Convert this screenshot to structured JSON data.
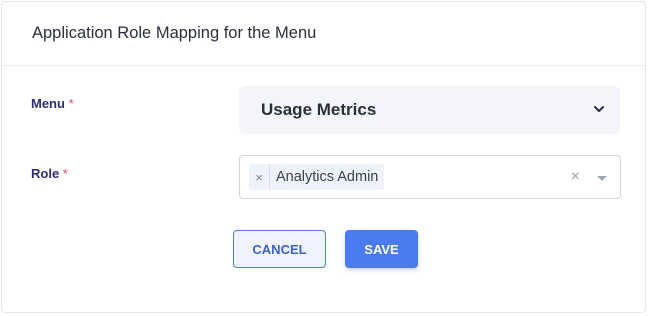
{
  "dialog": {
    "title": "Application Role Mapping for the Menu"
  },
  "menu_field": {
    "label": "Menu",
    "required_mark": "*",
    "selected_value": "Usage Metrics",
    "chevron_icon": "chevron-down-icon"
  },
  "role_field": {
    "label": "Role",
    "required_mark": "*",
    "selected_tags": [
      {
        "label": "Analytics Admin",
        "remove_symbol": "×"
      }
    ],
    "clear_symbol": "×",
    "dropdown_icon": "caret-down-icon"
  },
  "actions": {
    "cancel_label": "CANCEL",
    "save_label": "SAVE"
  },
  "colors": {
    "accent": "#4a7cf0",
    "label": "#2b2d7a",
    "required": "#e0446a",
    "menu_bg": "#f3f5fb"
  }
}
